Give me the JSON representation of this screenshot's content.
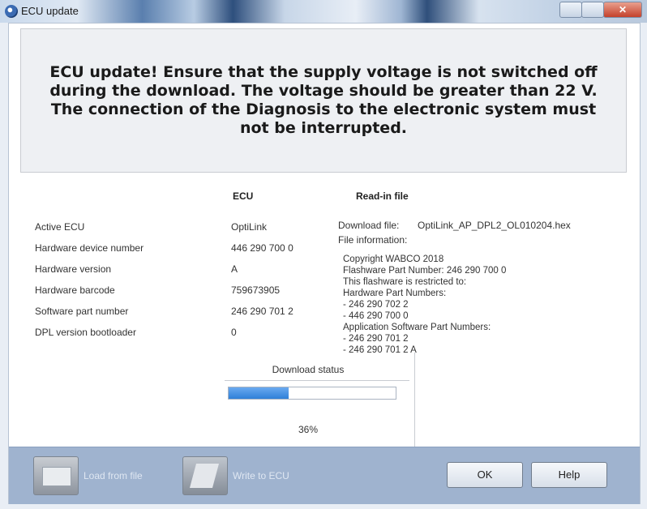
{
  "window": {
    "title": "ECU update"
  },
  "warning": "ECU update! Ensure that the supply voltage is not switched off during the download. The voltage should be greater than 22 V. The connection of the Diagnosis to the electronic system must not be interrupted.",
  "columns": {
    "ecu": "ECU",
    "read_in_file": "Read-in file"
  },
  "rows": [
    {
      "label": "Active ECU",
      "value": "OptiLink"
    },
    {
      "label": "Hardware device number",
      "value": "446 290 700 0"
    },
    {
      "label": "Hardware version",
      "value": "A"
    },
    {
      "label": "Hardware barcode",
      "value": "759673905"
    },
    {
      "label": "Software part number",
      "value": "246 290 701 2"
    },
    {
      "label": "DPL version bootloader",
      "value": "0"
    }
  ],
  "read_in": {
    "download_file_label": "Download file:",
    "download_file_value": "OptiLink_AP_DPL2_OL010204.hex",
    "file_info_label": "File information:",
    "info_lines": [
      "Copyright WABCO 2018",
      "Flashware Part Number: 246 290 700 0",
      "This flashware is restricted to:",
      "Hardware Part Numbers:",
      "- 246 290 702 2",
      "- 446 290 700 0",
      "Application Software Part Numbers:",
      "- 246 290 701 2",
      "- 246 290 701 2 A"
    ]
  },
  "download_status": {
    "label": "Download status",
    "percent": 36,
    "percent_text": "36%"
  },
  "buttons": {
    "load_from_file": "Load from file",
    "write_to_ecu": "Write to ECU",
    "ok": "OK",
    "help": "Help"
  },
  "colors": {
    "progress": "#2f7fd8",
    "bottom_bar": "#9fb3cf"
  },
  "icons": [
    "ecu-app-icon",
    "load-file-icon",
    "write-ecu-icon"
  ]
}
